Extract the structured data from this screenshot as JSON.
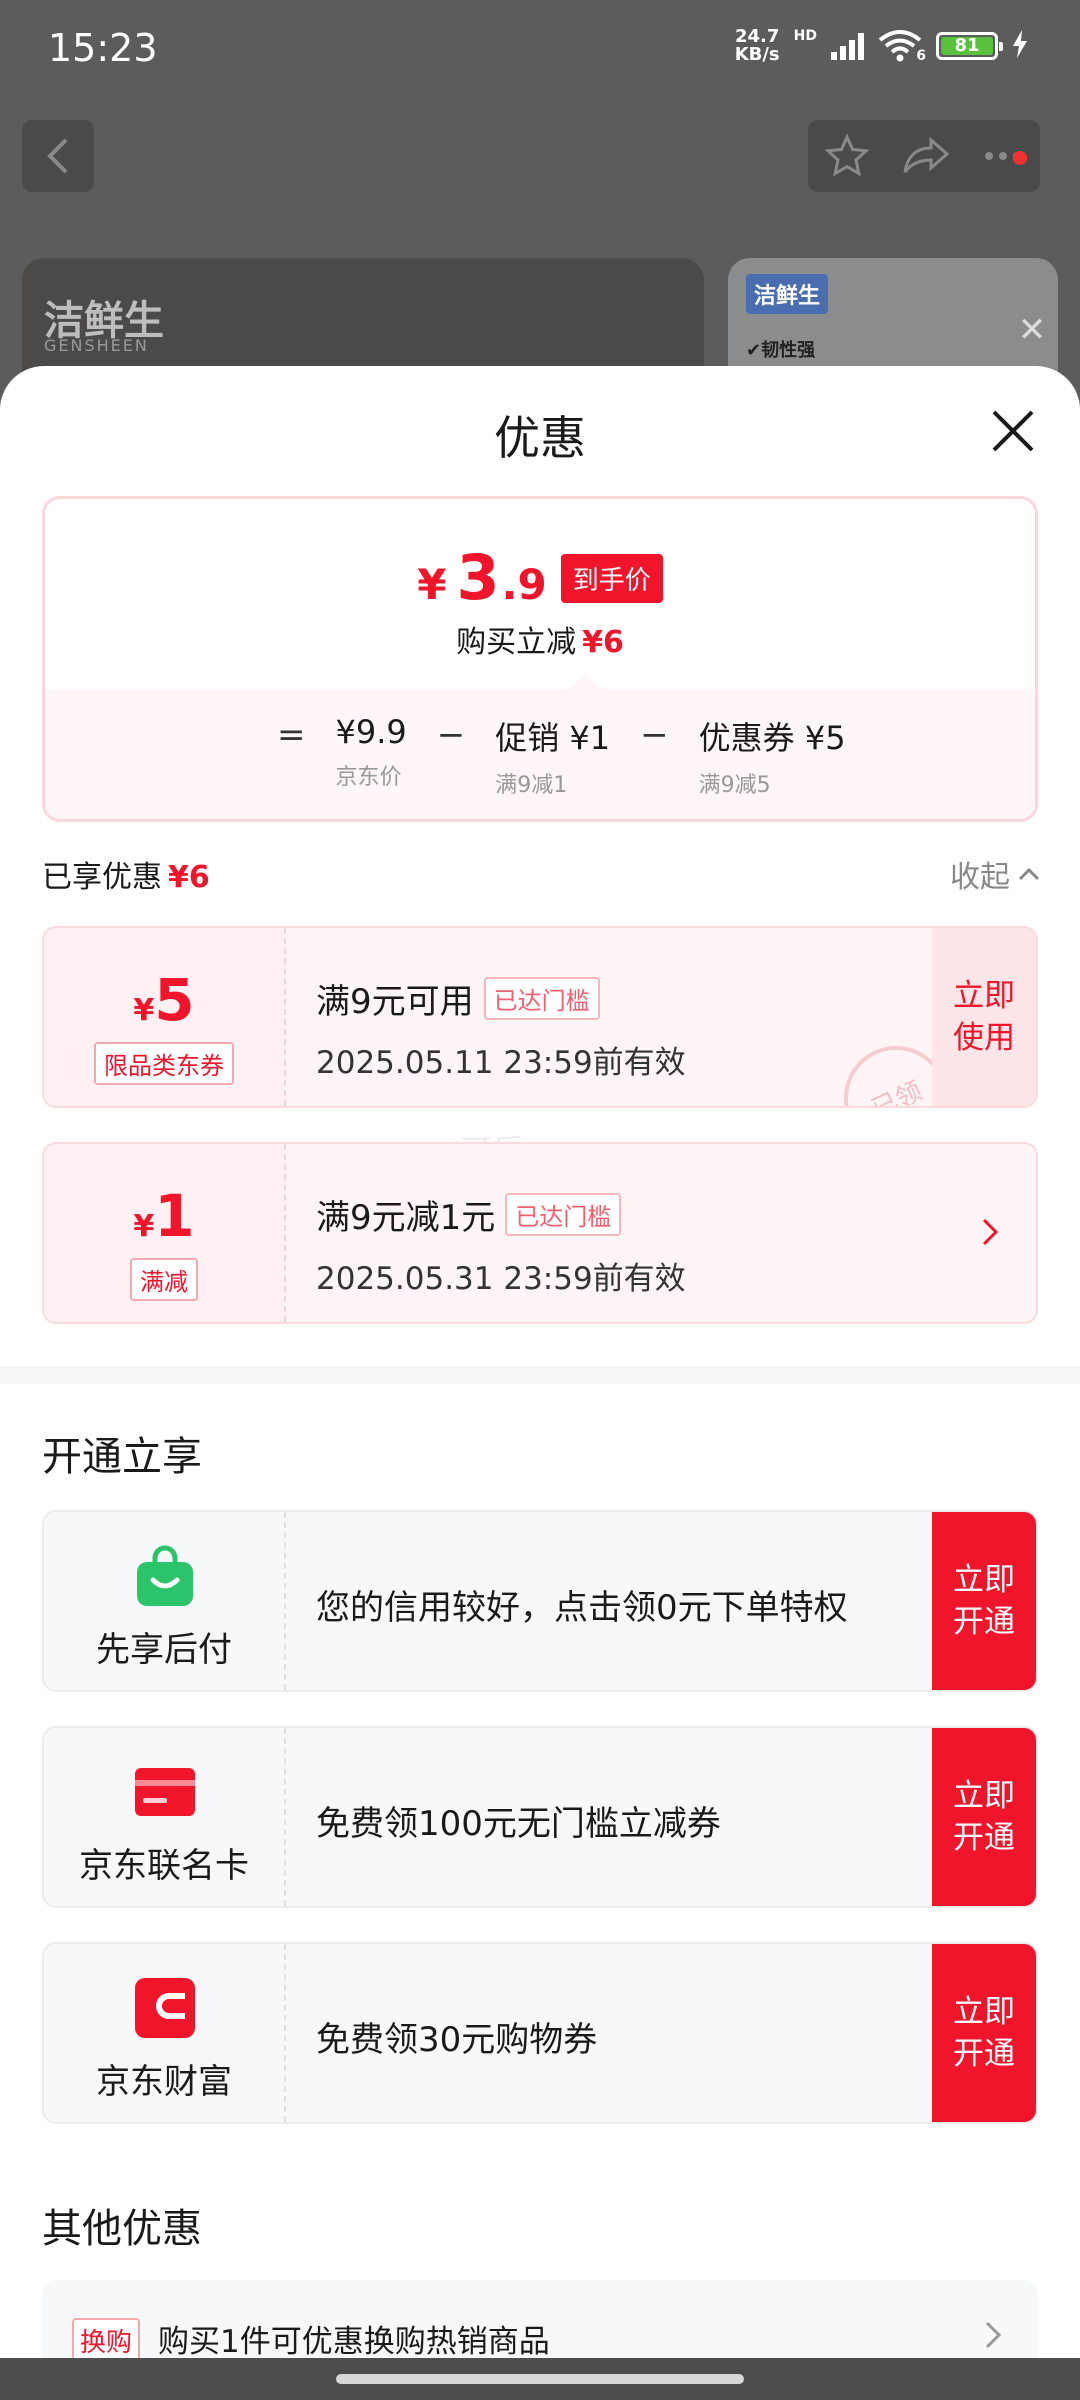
{
  "status": {
    "time": "15:23",
    "net_speed_value": "24.7",
    "net_speed_unit": "KB/s",
    "network_type": "HD",
    "wifi_label": "6",
    "battery": "81"
  },
  "background": {
    "brand_cn": "洁鲜生",
    "brand_en": "GENSHEEN",
    "card2_brand": "洁鲜生",
    "card2_feature": "✔韧性强"
  },
  "sheet": {
    "title": "优惠"
  },
  "summary": {
    "price_yen": "¥",
    "price_int": "3",
    "price_dec": ".9",
    "price_tag": "到手价",
    "reduce_label": "购买立减",
    "reduce_value": "¥6",
    "equals": "=",
    "minus": "−",
    "terms": [
      {
        "main": "¥9.9",
        "sub": "京东价"
      },
      {
        "main": "促销 ¥1",
        "sub": "满9减1"
      },
      {
        "main": "优惠券 ¥5",
        "sub": "满9减5"
      }
    ]
  },
  "enjoyed": {
    "label": "已享优惠",
    "value": "¥6",
    "collapse": "收起"
  },
  "coupons": [
    {
      "yen": "¥",
      "amount": "5",
      "tag": "限品类东券",
      "title": "满9元可用",
      "badge": "已达门槛",
      "date": "2025.05.11 23:59前有效",
      "action": "立即使用",
      "stamp": "已领"
    },
    {
      "yen": "¥",
      "amount": "1",
      "tag": "满减",
      "title": "满9元减1元",
      "badge": "已达门槛",
      "date": "2025.05.31 23:59前有效"
    }
  ],
  "watermark": "可乐-",
  "open_section": {
    "title": "开通立享",
    "items": [
      {
        "name": "先享后付",
        "desc": "您的信用较好，点击领0元下单特权",
        "action": "立即开通",
        "icon": "shopping-bag-icon",
        "color": "#2bc46a"
      },
      {
        "name": "京东联名卡",
        "desc": "免费领100元无门槛立减券",
        "action": "立即开通",
        "icon": "credit-card-icon",
        "color": "#f0152b"
      },
      {
        "name": "京东财富",
        "desc": "免费领30元购物券",
        "action": "立即开通",
        "icon": "wallet-icon",
        "color": "#f0152b"
      }
    ]
  },
  "other_section": {
    "title": "其他优惠",
    "items": [
      {
        "badge": "换购",
        "text": "购买1件可优惠换购热销商品"
      }
    ]
  },
  "colors": {
    "accent": "#f0152b",
    "open_green": "#2bc46a"
  }
}
